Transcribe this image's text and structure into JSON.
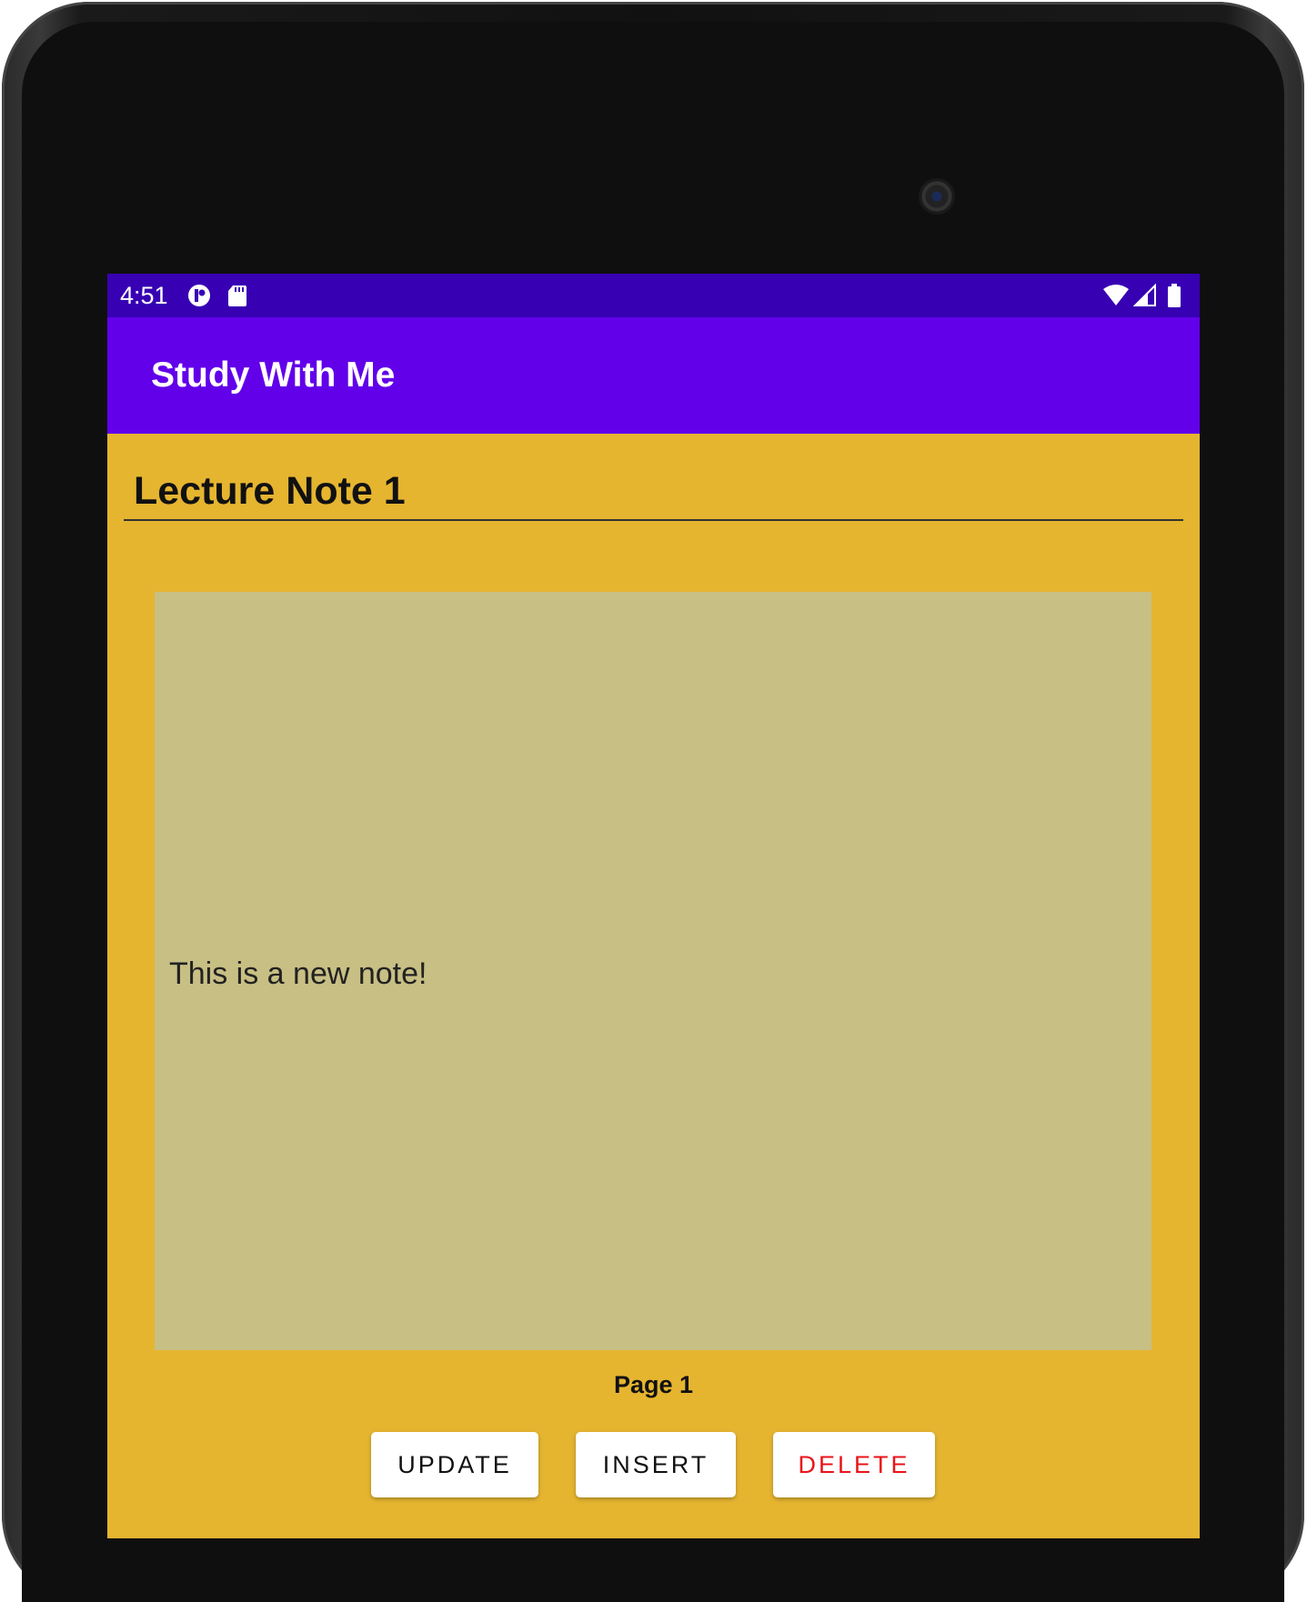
{
  "status_bar": {
    "time": "4:51",
    "left_icons": [
      "app-notification-icon",
      "sd-card-icon"
    ],
    "right_icons": [
      "wifi-icon",
      "cell-signal-icon",
      "battery-icon"
    ],
    "color": "#3700b3"
  },
  "app_bar": {
    "title": "Study With Me",
    "color": "#6200ea"
  },
  "note": {
    "title": "Lecture Note 1",
    "body": "This is a new note!",
    "page_label": "Page 1",
    "background_color": "#e5b530",
    "body_color": "#c8bf84"
  },
  "buttons": {
    "update": "UPDATE",
    "insert": "INSERT",
    "delete": "DELETE",
    "delete_color": "#e8141a"
  }
}
